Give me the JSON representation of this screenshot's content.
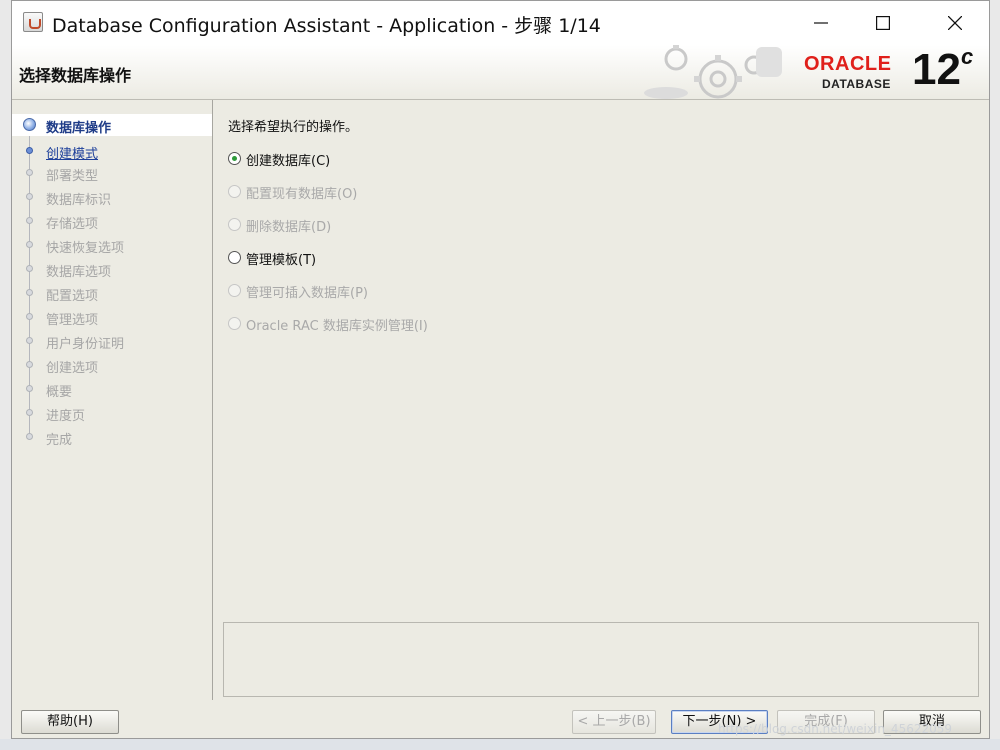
{
  "window": {
    "title": "Database Configuration Assistant - Application - 步骤 1/14"
  },
  "header": {
    "title": "选择数据库操作",
    "logo": {
      "brand": "ORACLE",
      "product": "DATABASE",
      "version": "12",
      "version_suffix": "c"
    }
  },
  "steps": [
    {
      "label": "数据库操作",
      "state": "active"
    },
    {
      "label": "创建模式",
      "state": "link"
    },
    {
      "label": "部署类型",
      "state": "disabled"
    },
    {
      "label": "数据库标识",
      "state": "disabled"
    },
    {
      "label": "存储选项",
      "state": "disabled"
    },
    {
      "label": "快速恢复选项",
      "state": "disabled"
    },
    {
      "label": "数据库选项",
      "state": "disabled"
    },
    {
      "label": "配置选项",
      "state": "disabled"
    },
    {
      "label": "管理选项",
      "state": "disabled"
    },
    {
      "label": "用户身份证明",
      "state": "disabled"
    },
    {
      "label": "创建选项",
      "state": "disabled"
    },
    {
      "label": "概要",
      "state": "disabled"
    },
    {
      "label": "进度页",
      "state": "disabled"
    },
    {
      "label": "完成",
      "state": "disabled"
    }
  ],
  "main": {
    "prompt": "选择希望执行的操作。",
    "options": [
      {
        "label": "创建数据库(C)",
        "checked": true,
        "enabled": true
      },
      {
        "label": "配置现有数据库(O)",
        "checked": false,
        "enabled": false
      },
      {
        "label": "删除数据库(D)",
        "checked": false,
        "enabled": false
      },
      {
        "label": "管理模板(T)",
        "checked": false,
        "enabled": true
      },
      {
        "label": "管理可插入数据库(P)",
        "checked": false,
        "enabled": false
      },
      {
        "label": "Oracle RAC 数据库实例管理(I)",
        "checked": false,
        "enabled": false
      }
    ]
  },
  "footer": {
    "help": "帮助(H)",
    "back": "< 上一步(B)",
    "next": "下一步(N) >",
    "finish": "完成(F)",
    "cancel": "取消"
  },
  "watermark": "https://blog.csdn.net/weixin_45622059"
}
